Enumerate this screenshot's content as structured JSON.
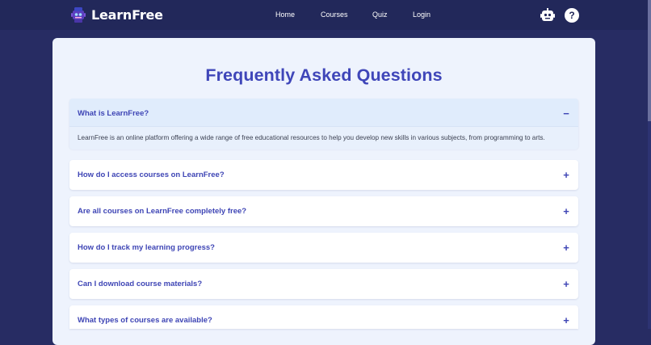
{
  "nav": {
    "brand": "LearnFree",
    "links": [
      "Home",
      "Courses",
      "Quiz",
      "Login"
    ],
    "actions": [
      "robot-icon",
      "help-icon"
    ]
  },
  "page": {
    "title": "Frequently Asked Questions"
  },
  "faq": [
    {
      "question": "What is LearnFree?",
      "answer": "LearnFree is an online platform offering a wide range of free educational resources to help you develop new skills in various subjects, from programming to arts.",
      "expanded": true,
      "toggle": "−"
    },
    {
      "question": "How do I access courses on LearnFree?",
      "expanded": false,
      "toggle": "+"
    },
    {
      "question": "Are all courses on LearnFree completely free?",
      "expanded": false,
      "toggle": "+"
    },
    {
      "question": "How do I track my learning progress?",
      "expanded": false,
      "toggle": "+"
    },
    {
      "question": "Can I download course materials?",
      "expanded": false,
      "toggle": "+"
    },
    {
      "question": "What types of courses are available?",
      "expanded": false,
      "toggle": "+"
    }
  ],
  "colors": {
    "background": "#272c63",
    "navbar": "#22285a",
    "card": "#eef3fd",
    "accent": "#3f46b9"
  }
}
